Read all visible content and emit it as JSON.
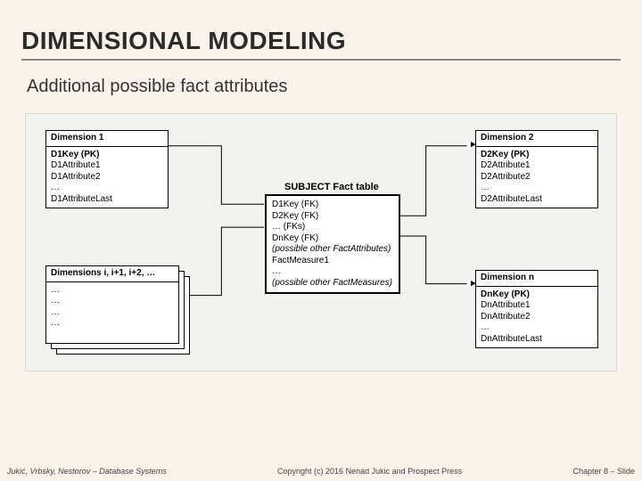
{
  "title": "DIMENSIONAL MODELING",
  "subtitle": "Additional possible fact attributes",
  "fact": {
    "label": "SUBJECT Fact table",
    "rows": [
      {
        "t": "D1Key (FK)",
        "style": "plain"
      },
      {
        "t": "D2Key (FK)",
        "style": "plain"
      },
      {
        "t": "…     (FKs)",
        "style": "plain"
      },
      {
        "t": "DnKey (FK)",
        "style": "plain"
      },
      {
        "t": "(possible other FactAttributes)",
        "style": "italic"
      },
      {
        "t": "FactMeasure1",
        "style": "plain"
      },
      {
        "t": "…",
        "style": "plain"
      },
      {
        "t": "(possible other FactMeasures)",
        "style": "italic"
      }
    ]
  },
  "dim1": {
    "header": "Dimension 1",
    "rows": [
      "D1Key (PK)",
      "D1Attribute1",
      "D1Attribute2",
      "…",
      "D1AttributeLast"
    ]
  },
  "dim2": {
    "header": "Dimension 2",
    "rows": [
      "D2Key (PK)",
      "D2Attribute1",
      "D2Attribute2",
      "…",
      "D2AttributeLast"
    ]
  },
  "dimn": {
    "header": "Dimension n",
    "rows": [
      "DnKey (PK)",
      "DnAttribute1",
      "DnAttribute2",
      "…",
      "DnAttributeLast"
    ]
  },
  "dimStack": {
    "header": "Dimensions i, i+1, i+2, …",
    "rows": [
      "…",
      "…",
      "…",
      "…"
    ]
  },
  "footer": {
    "left": "Jukić, Vrbsky, Nestorov – Database Systems",
    "mid": "Copyright (c) 2016 Nenad Jukic and Prospect Press",
    "right": "Chapter 8 – Slide"
  }
}
